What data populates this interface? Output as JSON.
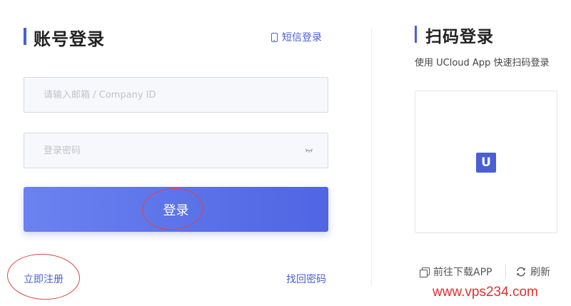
{
  "account_login": {
    "title": "账号登录",
    "sms_login_label": "短信登录",
    "email_placeholder": "请输入邮箱 / Company ID",
    "password_placeholder": "登录密码",
    "login_button_label": "登录",
    "register_label": "立即注册",
    "forgot_password_label": "找回密码"
  },
  "qr_login": {
    "title": "扫码登录",
    "subtitle": "使用 UCloud App 快速扫码登录",
    "logo_letter": "U",
    "download_label": "前往下载APP",
    "refresh_label": "刷新"
  },
  "watermark": "www.vps234.com",
  "colors": {
    "accent": "#4a5fd6",
    "button_gradient_start": "#6b82f0",
    "button_gradient_end": "#4f65e3",
    "annotation_red": "#d64848",
    "watermark_red": "#e03030"
  },
  "icons": [
    "phone-icon",
    "eye-closed-icon",
    "copy-icon",
    "refresh-icon"
  ]
}
